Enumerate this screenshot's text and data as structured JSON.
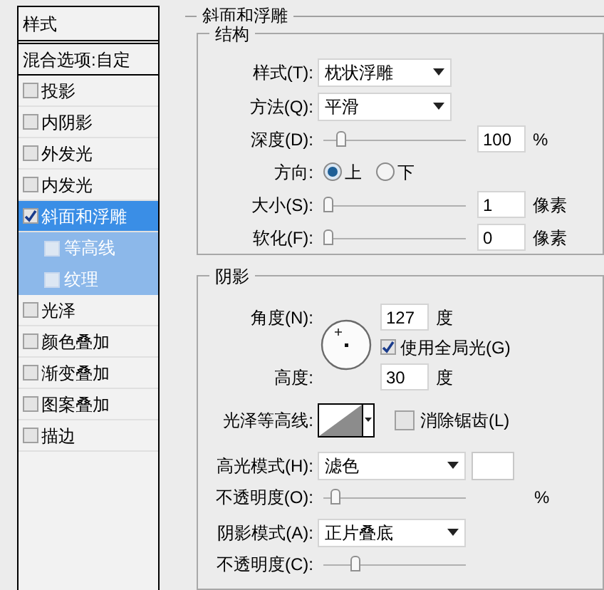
{
  "sidebar": {
    "header": "样式",
    "blend_options": "混合选项:自定",
    "items": [
      {
        "label": "投影",
        "checked": false,
        "selected": false
      },
      {
        "label": "内阴影",
        "checked": false,
        "selected": false
      },
      {
        "label": "外发光",
        "checked": false,
        "selected": false
      },
      {
        "label": "内发光",
        "checked": false,
        "selected": false
      },
      {
        "label": "斜面和浮雕",
        "checked": true,
        "selected": true,
        "children": [
          {
            "label": "等高线",
            "checked": false
          },
          {
            "label": "纹理",
            "checked": false
          }
        ]
      },
      {
        "label": "光泽",
        "checked": false,
        "selected": false
      },
      {
        "label": "颜色叠加",
        "checked": false,
        "selected": false
      },
      {
        "label": "渐变叠加",
        "checked": false,
        "selected": false
      },
      {
        "label": "图案叠加",
        "checked": false,
        "selected": false
      },
      {
        "label": "描边",
        "checked": false,
        "selected": false
      }
    ]
  },
  "section_title": "斜面和浮雕",
  "structure": {
    "title": "结构",
    "style": {
      "label": "样式(T):",
      "value": "枕状浮雕"
    },
    "technique": {
      "label": "方法(Q):",
      "value": "平滑"
    },
    "depth": {
      "label": "深度(D):",
      "level": 0.1,
      "value": "100",
      "unit": "%"
    },
    "direction": {
      "label": "方向:",
      "options": [
        {
          "label": "上",
          "selected": true
        },
        {
          "label": "下",
          "selected": false
        }
      ]
    },
    "size": {
      "label": "大小(S):",
      "level": 0,
      "value": "1",
      "unit": "像素"
    },
    "soften": {
      "label": "软化(F):",
      "level": 0,
      "value": "0",
      "unit": "像素"
    }
  },
  "shading": {
    "title": "阴影",
    "angle": {
      "label": "角度(N):",
      "value": "127",
      "unit": "度"
    },
    "global_light": {
      "label": "使用全局光(G)",
      "checked": true
    },
    "altitude": {
      "label": "高度:",
      "value": "30",
      "unit": "度"
    },
    "gloss_contour": {
      "label": "光泽等高线:"
    },
    "anti_aliased": {
      "label": "消除锯齿(L)",
      "checked": false
    },
    "highlight_mode": {
      "label": "高光模式(H):",
      "value": "滤色"
    },
    "highlight_opacity": {
      "label": "不透明度(O):",
      "level": 0.05,
      "unit": "%"
    },
    "shadow_mode": {
      "label": "阴影模式(A):",
      "value": "正片叠底"
    },
    "shadow_opacity": {
      "label": "不透明度(C):",
      "level": 0.2
    }
  }
}
